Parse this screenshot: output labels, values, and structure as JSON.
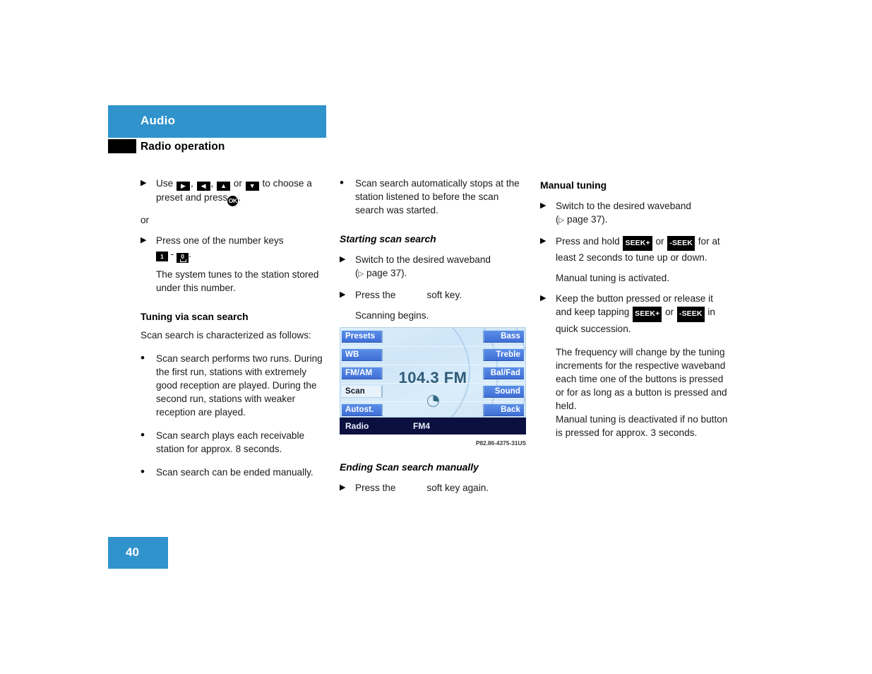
{
  "header": {
    "section_title": "Audio",
    "page_title": "Radio operation"
  },
  "footer": {
    "page_number": "40"
  },
  "column1": {
    "step_use_prefix": "Use",
    "step_use_middle": "to choose a preset and press",
    "keys": {
      "right": "▶",
      "left": "◀",
      "up": "▲",
      "down": "▼",
      "ok": "OK",
      "num_one": "1",
      "num_zero": "0"
    },
    "comma": ",",
    "or_word": "or",
    "or_label": "or",
    "period": ".",
    "step_number_keys": "Press one of the number keys",
    "dash": "-",
    "result_number_keys": "The system tunes to the station stored under this number.",
    "heading_tuning": "Tuning via scan search",
    "intro_tuning": "Scan search is characterized as follows:",
    "bullets": [
      "Scan search performs two runs. During the first run, stations with extremely good reception are played. During the second run, stations with weaker reception are played.",
      "Scan search plays each receivable station for approx. 8 seconds.",
      "Scan search can be ended manually."
    ]
  },
  "column2": {
    "bullet_autostop": "Scan search automatically stops at the station listened to before the scan search was started.",
    "heading_starting": "Starting scan search",
    "step_waveband": "Switch to the desired waveband",
    "page_ref": "page 37",
    "page_ref_open": "(",
    "page_ref_close": ").",
    "step_press_prefix": "Press the",
    "step_press_suffix": "soft key.",
    "result_scanning": "Scanning begins.",
    "heading_ending": "Ending Scan search manually",
    "step_press_again_prefix": "Press the",
    "step_press_again_suffix": "soft key again."
  },
  "radio_display": {
    "left_buttons": [
      "Presets",
      "WB",
      "FM/AM",
      "Scan",
      "Autost."
    ],
    "selected_left_button": "Scan",
    "right_buttons": [
      "Bass",
      "Treble",
      "Bal/Fad",
      "Sound",
      "Back"
    ],
    "frequency": "104.3 FM",
    "status_left": "Radio",
    "status_center": "FM4",
    "caption": "P82.86-4375-31US",
    "colors": {
      "button_blue": "#3f6fd8",
      "selected_button": "#e8f2fb",
      "status_bar": "#0c1040",
      "frequency_text": "#2f5b78"
    }
  },
  "column3": {
    "heading_manual": "Manual tuning",
    "step_waveband": "Switch to the desired waveband",
    "page_ref": "page 37",
    "page_ref_open": "(",
    "page_ref_close": ").",
    "step_hold_prefix": "Press and hold",
    "step_hold_or": "or",
    "step_hold_suffix": "for at least 2 seconds to tune up or down.",
    "seek_plus": "SEEK+",
    "seek_minus": "-SEEK",
    "result_activated": "Manual tuning is activated.",
    "step_tap_prefix": "Keep the button pressed or release it and keep tapping",
    "step_tap_or": "or",
    "step_tap_suffix": "in quick succession.",
    "result_frequency": "The frequency will change by the tuning increments for the respective waveband each time one of the buttons is pressed or for as long as a button is pressed and held.",
    "result_deactivated": "Manual tuning is deactivated if no button is pressed for approx. 3 seconds."
  },
  "markers": {
    "arrow": "▶",
    "bullet": "•",
    "page_triangle": "▷"
  },
  "colors": {
    "accent_blue": "#3093cc",
    "tab_black": "#000000"
  }
}
